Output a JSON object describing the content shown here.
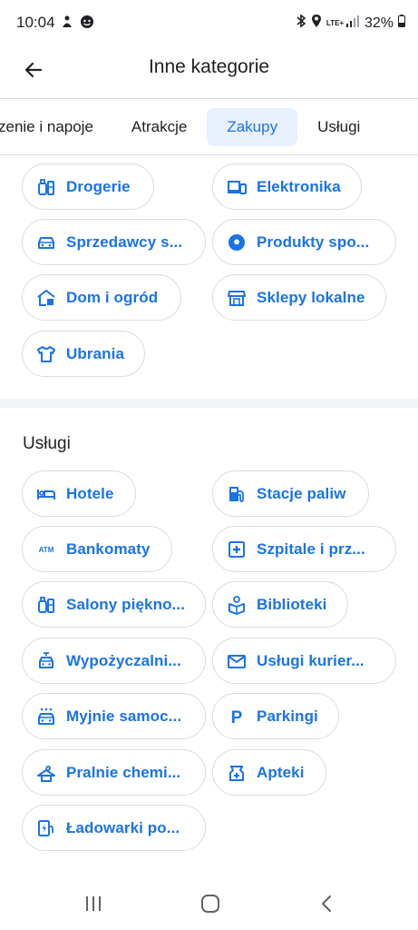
{
  "status_bar": {
    "time": "10:04",
    "lte": "LTE+",
    "battery": "32%"
  },
  "app_bar": {
    "title": "Inne kategorie"
  },
  "tabs": [
    {
      "label": "zenie i napoje",
      "active": false
    },
    {
      "label": "Atrakcje",
      "active": false
    },
    {
      "label": "Zakupy",
      "active": true
    },
    {
      "label": "Usługi",
      "active": false
    }
  ],
  "shopping_chips": [
    {
      "label": "Drogerie",
      "icon": "drugstore-icon"
    },
    {
      "label": "Elektronika",
      "icon": "devices-icon"
    },
    {
      "label": "Sprzedawcy s...",
      "icon": "car-icon"
    },
    {
      "label": "Produkty spo...",
      "icon": "soccer-ball-icon"
    },
    {
      "label": "Dom i ogród",
      "icon": "home-garden-icon"
    },
    {
      "label": "Sklepy lokalne",
      "icon": "storefront-icon"
    },
    {
      "label": "Ubrania",
      "icon": "shirt-icon"
    }
  ],
  "services": {
    "title": "Usługi",
    "chips": [
      {
        "label": "Hotele",
        "icon": "bed-icon"
      },
      {
        "label": "Stacje paliw",
        "icon": "gas-station-icon"
      },
      {
        "label": "Bankomaty",
        "icon": "atm-icon"
      },
      {
        "label": "Szpitale i prz...",
        "icon": "hospital-icon"
      },
      {
        "label": "Salony piękno...",
        "icon": "beauty-icon"
      },
      {
        "label": "Biblioteki",
        "icon": "library-icon"
      },
      {
        "label": "Wypożyczalni...",
        "icon": "car-rental-icon"
      },
      {
        "label": "Usługi kurier...",
        "icon": "mail-icon"
      },
      {
        "label": "Myjnie samoc...",
        "icon": "car-wash-icon"
      },
      {
        "label": "Parkingi",
        "icon": "parking-icon"
      },
      {
        "label": "Pralnie chemi...",
        "icon": "dry-cleaning-icon"
      },
      {
        "label": "Apteki",
        "icon": "pharmacy-icon"
      },
      {
        "label": "Ładowarki po...",
        "icon": "ev-charger-icon"
      }
    ]
  },
  "colors": {
    "accent": "#1a73e8",
    "active_tab_bg": "#e8f0fe",
    "chip_border": "#dadce0",
    "text": "#202124"
  }
}
